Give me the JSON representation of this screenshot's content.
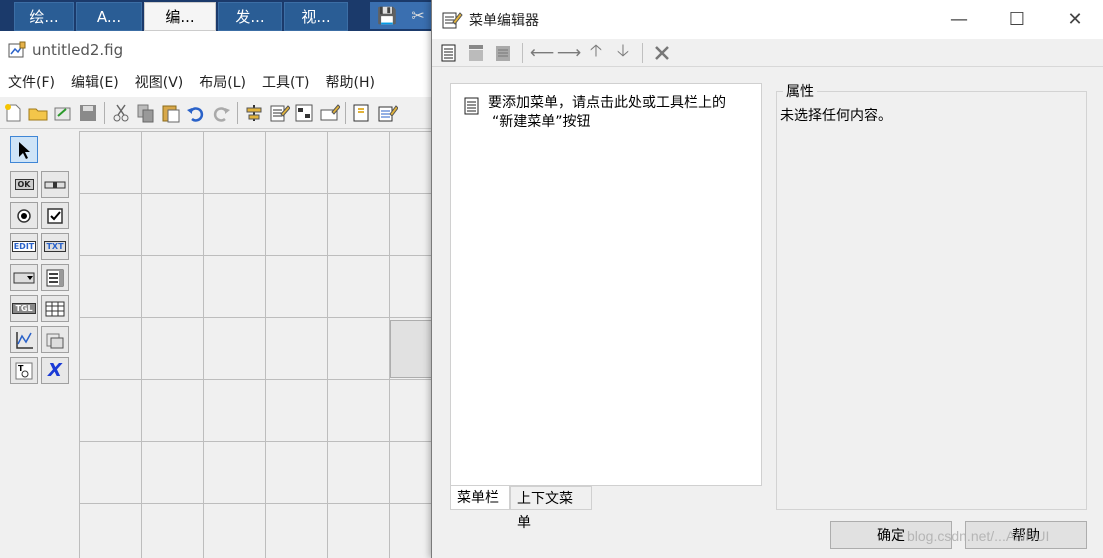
{
  "taskbar": {
    "tabs": [
      {
        "label": "绘..."
      },
      {
        "label": "A..."
      },
      {
        "label": "编..."
      },
      {
        "label": "发..."
      },
      {
        "label": "视..."
      }
    ]
  },
  "guide": {
    "title": "untitled2.fig",
    "menus": [
      "文件(F)",
      "编辑(E)",
      "视图(V)",
      "布局(L)",
      "工具(T)",
      "帮助(H)"
    ],
    "palette": [
      "OK",
      "",
      "",
      "",
      "EDIT",
      "TXT",
      "",
      "",
      "TGL",
      "",
      "",
      "",
      "",
      "X"
    ]
  },
  "dialog": {
    "title": "菜单编辑器",
    "minimize": "—",
    "maximize": "☐",
    "close": "✕",
    "hint_line1": "要添加菜单，请点击此处或工具栏上的",
    "hint_line2": "“新建菜单”按钮",
    "tabs": {
      "menubar": "菜单栏",
      "context": "上下文菜单"
    },
    "properties": {
      "legend": "属性",
      "empty_text": "未选择任何内容。"
    },
    "buttons": {
      "ok": "确定",
      "help": "帮助"
    },
    "watermark": "blog.csdn.net/...ANHUI"
  },
  "colors": {
    "taskbar": "#1b3a6b",
    "tab": "#2a5d95",
    "selected": "#cfe4f7"
  }
}
